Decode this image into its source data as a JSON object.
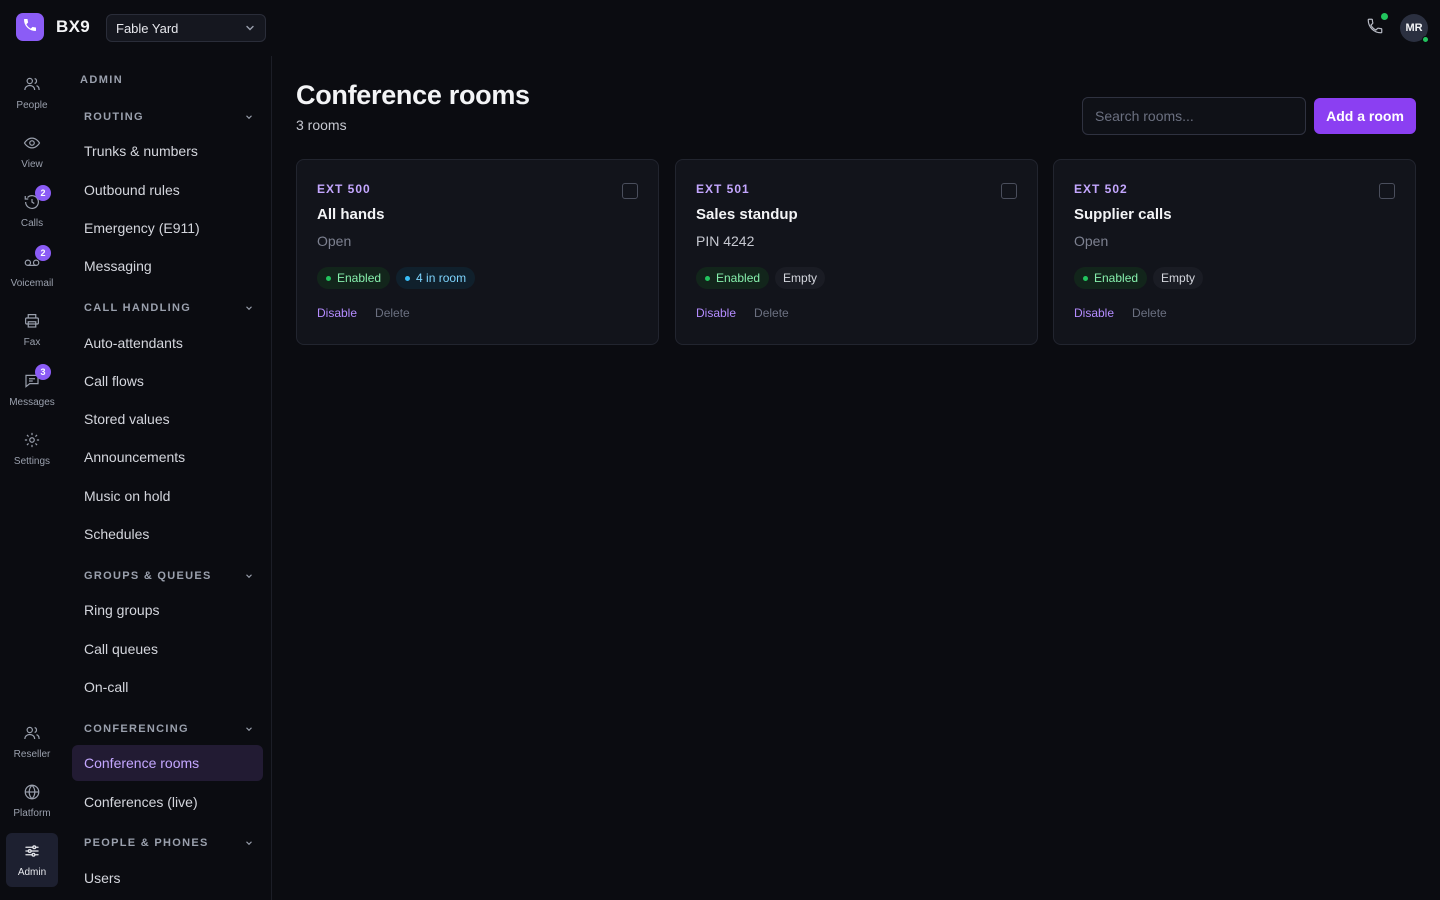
{
  "app": {
    "brand": "BX9",
    "tenant": "Fable Yard",
    "user_initials": "MR",
    "accent": "#8b5cf6"
  },
  "rail": [
    {
      "label": "People",
      "icon": "people-icon",
      "badge": ""
    },
    {
      "label": "View",
      "icon": "eye-icon",
      "badge": ""
    },
    {
      "label": "Calls",
      "icon": "history-icon",
      "badge": "2"
    },
    {
      "label": "Voicemail",
      "icon": "voicemail-icon",
      "badge": "2"
    },
    {
      "label": "Fax",
      "icon": "printer-icon",
      "badge": ""
    },
    {
      "label": "Messages",
      "icon": "message-icon",
      "badge": "3"
    },
    {
      "label": "Settings",
      "icon": "gear-icon",
      "badge": ""
    },
    {
      "label": "Reseller",
      "icon": "reseller-icon",
      "badge": ""
    },
    {
      "label": "Platform",
      "icon": "globe-icon",
      "badge": ""
    },
    {
      "label": "Admin",
      "icon": "sliders-icon",
      "badge": ""
    }
  ],
  "sidebar": {
    "heading": "ADMIN",
    "sections": {
      "routing": "ROUTING",
      "call_handling": "CALL HANDLING",
      "groups_queues": "GROUPS & QUEUES",
      "conferencing": "CONFERENCING",
      "people_phones": "PEOPLE & PHONES"
    },
    "items": {
      "trunks": "Trunks & numbers",
      "outbound": "Outbound rules",
      "emergency": "Emergency (E911)",
      "messaging": "Messaging",
      "auto_attendants": "Auto-attendants",
      "call_flows": "Call flows",
      "stored_values": "Stored values",
      "announcements": "Announcements",
      "music_on_hold": "Music on hold",
      "schedules": "Schedules",
      "ring_groups": "Ring groups",
      "call_queues": "Call queues",
      "on_call": "On-call",
      "conference_rooms": "Conference rooms",
      "conferences_live": "Conferences (live)",
      "users": "Users"
    }
  },
  "main": {
    "title": "Conference rooms",
    "subtitle": "3 rooms",
    "search_placeholder": "Search rooms...",
    "add_label": "Add a room",
    "rooms": [
      {
        "ext": "EXT 500",
        "name": "All hands",
        "access": "Open",
        "status": "Enabled",
        "occupancy": "4 in room",
        "disable": "Disable",
        "delete": "Delete"
      },
      {
        "ext": "EXT 501",
        "name": "Sales standup",
        "access": "PIN 4242",
        "status": "Enabled",
        "occupancy": "Empty",
        "disable": "Disable",
        "delete": "Delete"
      },
      {
        "ext": "EXT 502",
        "name": "Supplier calls",
        "access": "Open",
        "status": "Enabled",
        "occupancy": "Empty",
        "disable": "Disable",
        "delete": "Delete"
      }
    ]
  }
}
